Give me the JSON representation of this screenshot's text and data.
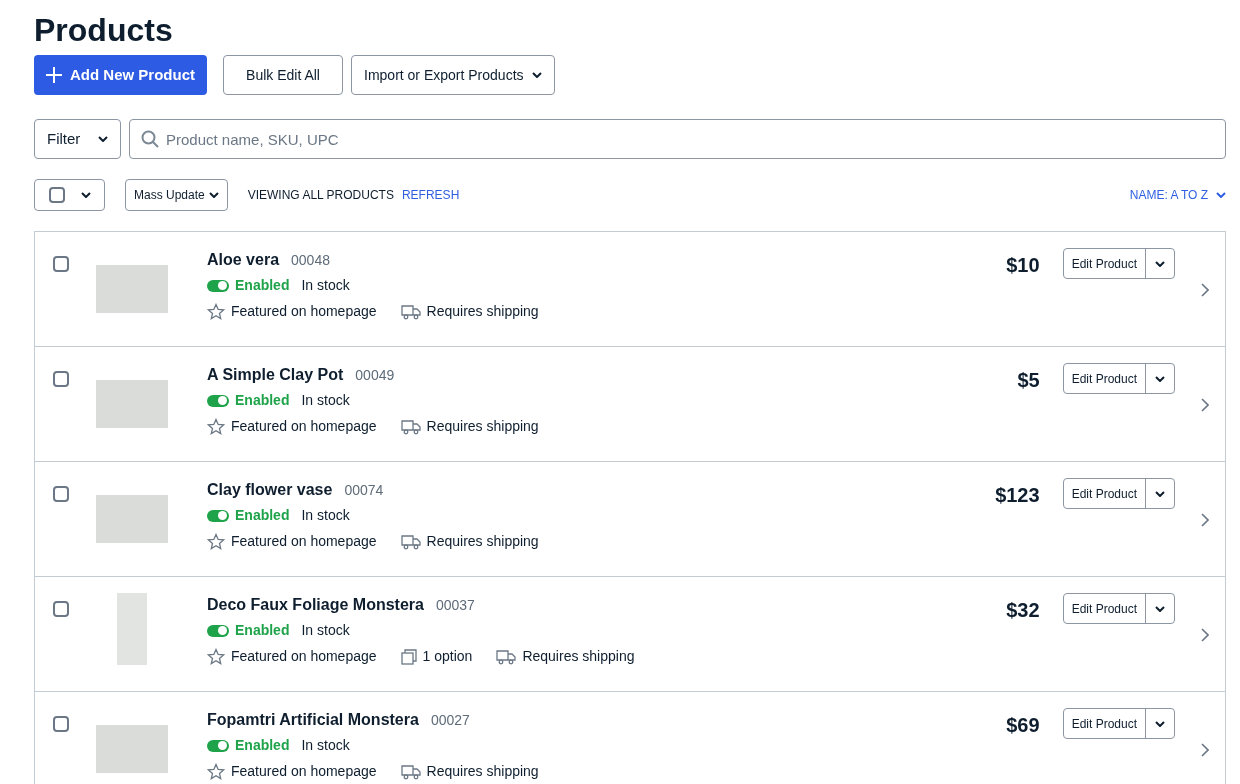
{
  "title": "Products",
  "actions": [
    {
      "kind": "primary",
      "label": "Add New Product"
    },
    {
      "kind": "plain",
      "label": "Bulk Edit All"
    },
    {
      "kind": "menu",
      "label": "Import or Export Products"
    }
  ],
  "filter": {
    "label": "Filter"
  },
  "search": {
    "placeholder": "Product name, SKU, UPC"
  },
  "toolbar": {
    "select_all_checked": false,
    "mass_update": "Mass Update",
    "viewing": "VIEWING ALL PRODUCTS",
    "refresh": "REFRESH",
    "sort": "NAME: A TO Z"
  },
  "products": [
    {
      "name": "Aloe vera",
      "sku": "00048",
      "kind": "landscape",
      "checked": false,
      "enabled": true,
      "status": "Enabled",
      "stock": "In stock",
      "price": "$10",
      "edit": "Edit Product",
      "tags": [
        {
          "kind": "featured",
          "label": "Featured on homepage"
        },
        {
          "kind": "shipping",
          "label": "Requires shipping"
        }
      ]
    },
    {
      "name": "A Simple Clay Pot",
      "sku": "00049",
      "kind": "landscape",
      "checked": false,
      "enabled": true,
      "status": "Enabled",
      "stock": "In stock",
      "price": "$5",
      "edit": "Edit Product",
      "tags": [
        {
          "kind": "featured",
          "label": "Featured on homepage"
        },
        {
          "kind": "shipping",
          "label": "Requires shipping"
        }
      ]
    },
    {
      "name": "Clay flower vase",
      "sku": "00074",
      "kind": "landscape",
      "checked": false,
      "enabled": true,
      "status": "Enabled",
      "stock": "In stock",
      "price": "$123",
      "edit": "Edit Product",
      "tags": [
        {
          "kind": "featured",
          "label": "Featured on homepage"
        },
        {
          "kind": "shipping",
          "label": "Requires shipping"
        }
      ]
    },
    {
      "name": "Deco Faux Foliage Monstera",
      "sku": "00037",
      "kind": "portrait",
      "checked": false,
      "enabled": true,
      "status": "Enabled",
      "stock": "In stock",
      "price": "$32",
      "edit": "Edit Product",
      "tags": [
        {
          "kind": "featured",
          "label": "Featured on homepage"
        },
        {
          "kind": "options",
          "label": "1 option"
        },
        {
          "kind": "shipping",
          "label": "Requires shipping"
        }
      ]
    },
    {
      "name": "Fopamtri Artificial Monstera",
      "sku": "00027",
      "kind": "landscape",
      "checked": false,
      "enabled": true,
      "status": "Enabled",
      "stock": "In stock",
      "price": "$69",
      "edit": "Edit Product",
      "tags": [
        {
          "kind": "featured",
          "label": "Featured on homepage"
        },
        {
          "kind": "shipping",
          "label": "Requires shipping"
        }
      ]
    }
  ]
}
